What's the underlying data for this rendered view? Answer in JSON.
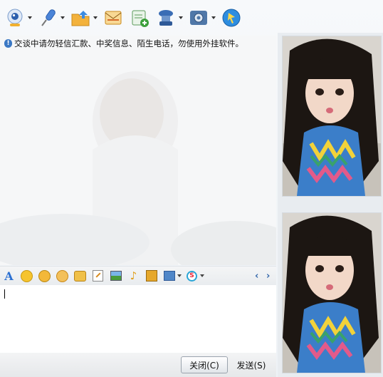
{
  "window": {
    "toolbar": [
      {
        "icon": "video-call-icon",
        "color": "#3f7ad6"
      },
      {
        "icon": "voice-call-icon",
        "color": "#4a84d8"
      },
      {
        "icon": "send-file-icon",
        "color": "#f0a62e"
      },
      {
        "icon": "message-icon",
        "color": "#e39a3a"
      },
      {
        "icon": "create-discussion-icon",
        "color": "#4ca64c"
      },
      {
        "icon": "remote-assist-icon",
        "color": "#3a6db5"
      },
      {
        "icon": "settings-icon",
        "color": "#5b7fa8"
      },
      {
        "icon": "app-share-icon",
        "color": "#2d8de0"
      }
    ],
    "notice": "交谈中请勿轻信汇款、中奖信息、陌生电话，勿使用外挂软件。",
    "format_bar": [
      {
        "icon": "font-icon",
        "glyph": "A"
      },
      {
        "icon": "emoticon-icon",
        "glyph": "☺"
      },
      {
        "icon": "magic-face-icon",
        "glyph": "☻"
      },
      {
        "icon": "shake-icon",
        "glyph": "✺"
      },
      {
        "icon": "voice-message-icon",
        "glyph": "✋"
      },
      {
        "icon": "handwrite-icon",
        "glyph": "✎"
      },
      {
        "icon": "image-icon",
        "glyph": "▣"
      },
      {
        "icon": "music-icon",
        "glyph": "♪"
      },
      {
        "icon": "screenshot-icon",
        "glyph": "✂"
      },
      {
        "icon": "screen-capture-icon",
        "glyph": "▤"
      },
      {
        "icon": "soso-icon",
        "glyph": "S"
      }
    ],
    "nav": {
      "prev": "‹",
      "next": "›"
    },
    "buttons": {
      "close": "关闭(C)",
      "send": "发送(S)"
    }
  }
}
